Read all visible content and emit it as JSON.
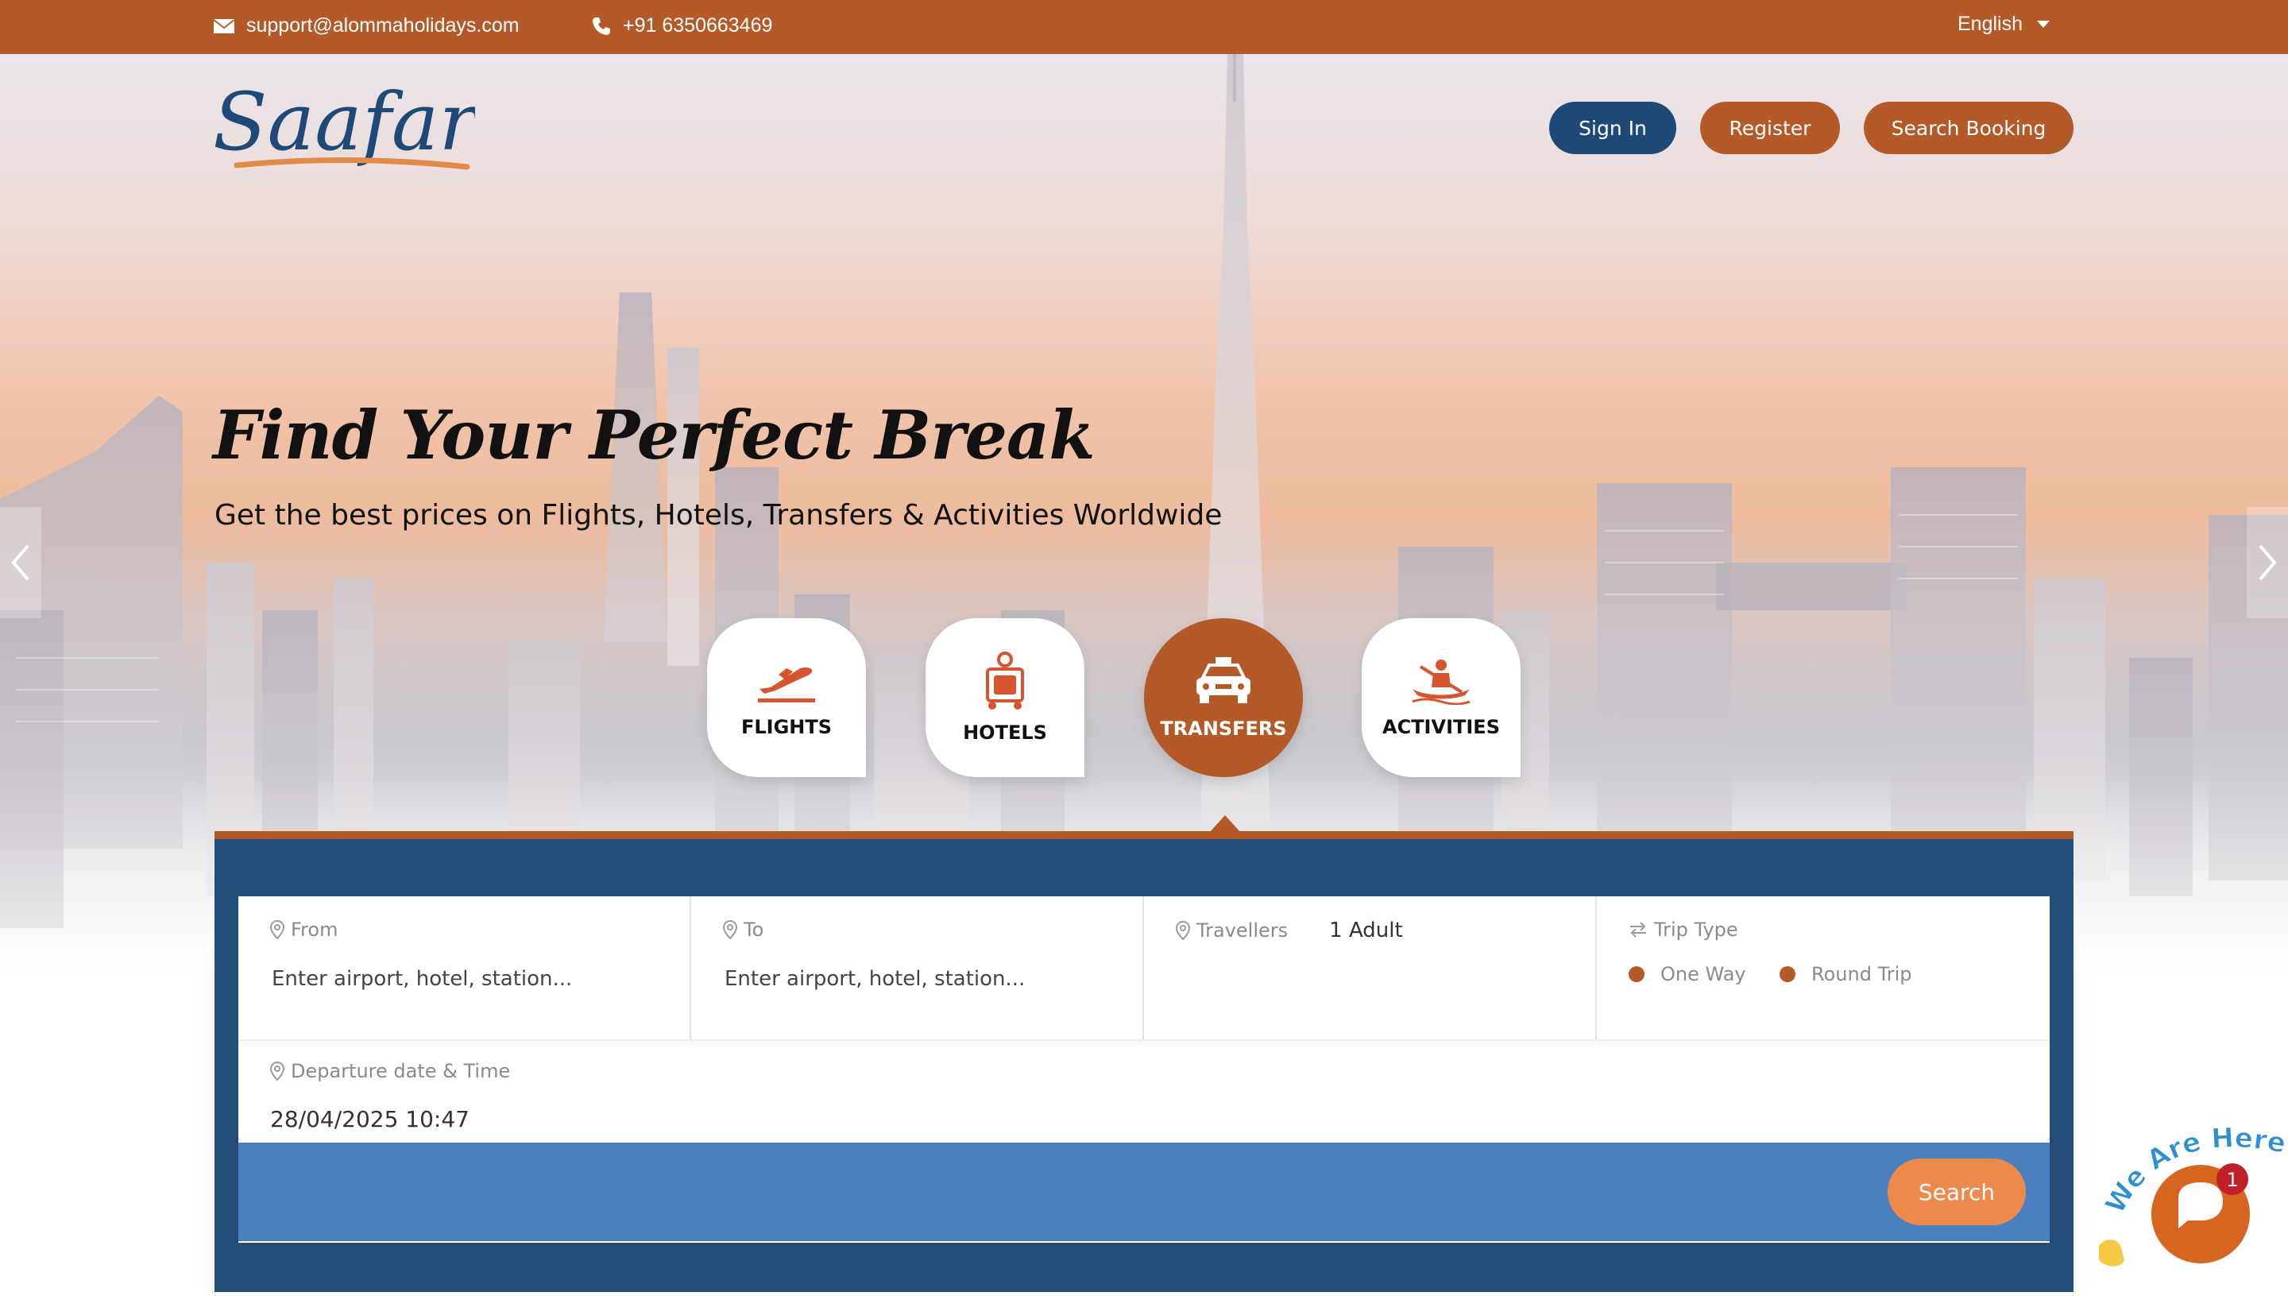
{
  "topbar": {
    "email": "support@alommaholidays.com",
    "phone": "+91 6350663469",
    "language": "English",
    "icons": {
      "email": "envelope-icon",
      "phone": "phone-icon",
      "language": "caret-down-icon"
    }
  },
  "brand": {
    "logo_text": "Saafar"
  },
  "header_buttons": {
    "sign_in": "Sign In",
    "register": "Register",
    "search_booking": "Search Booking"
  },
  "hero": {
    "headline": "Find Your Perfect Break",
    "subline": "Get the best prices on Flights, Hotels, Transfers & Activities Worldwide"
  },
  "tabs": [
    {
      "label": "FLIGHTS",
      "icon": "plane-icon",
      "active": false
    },
    {
      "label": "HOTELS",
      "icon": "luggage-icon",
      "active": false
    },
    {
      "label": "TRANSFERS",
      "icon": "taxi-icon",
      "active": true
    },
    {
      "label": "ACTIVITIES",
      "icon": "kayak-icon",
      "active": false
    }
  ],
  "form": {
    "from": {
      "label": "From",
      "placeholder": "Enter airport, hotel, station..."
    },
    "to": {
      "label": "To",
      "placeholder": "Enter airport, hotel, station..."
    },
    "travellers": {
      "label": "Travellers",
      "value": "1 Adult"
    },
    "trip_type": {
      "label": "Trip Type",
      "options": [
        "One Way",
        "Round Trip"
      ]
    },
    "departure": {
      "label": "Departure date & Time",
      "value": "28/04/2025 10:47"
    },
    "search_label": "Search"
  },
  "chat": {
    "badge": "1",
    "banner": "We Are Here!"
  },
  "colors": {
    "brand_orange": "#b45a29",
    "brand_blue": "#234c78",
    "search_bar_blue": "#4a7fbf",
    "search_button": "#ec8a4c"
  }
}
